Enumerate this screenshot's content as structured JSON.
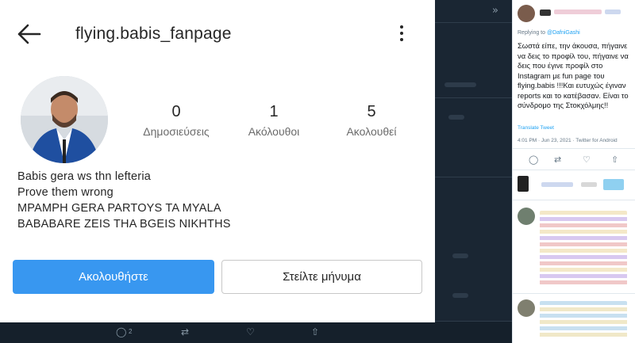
{
  "profile": {
    "username": "flying.babis_fanpage",
    "stats": [
      {
        "value": "0",
        "label": "Δημοσιεύσεις"
      },
      {
        "value": "1",
        "label": "Ακόλουθοι"
      },
      {
        "value": "5",
        "label": "Ακολουθεί"
      }
    ],
    "bio": [
      "Babis gera ws thn lefteria",
      "Prove them wrong",
      "ΜΡΑΜΡΗ GERA PARTOYS TA MYALA",
      "BABABARE ZEIS THA BGEIS NIKHTHS"
    ],
    "follow_label": "Ακολουθήστε",
    "message_label": "Στείλτε μήνυμα",
    "colors": {
      "accent": "#3897f0",
      "text": "#262626"
    }
  },
  "tweet": {
    "replying_prefix": "Replying to",
    "replying_handle": "@DafniGashi",
    "body": "Σωστά είπε, την άκουσα, πήγαινε να δεις το προφίλ του, πήγαινε να δεις που έγινε προφίλ στο Instagram με fun page του flying.babis !!!Και ευτυχώς έγιναν reports και το κατέβασαν. Είναι το σύνδρομο της Στοκχόλμης!!",
    "translate": "Translate Tweet",
    "meta": "4:01 PM · Jun 23, 2021 · Twitter for Android",
    "colors": {
      "link": "#1da1f2",
      "muted": "#657786"
    }
  },
  "background_tweet": {
    "reply_count": "2"
  }
}
